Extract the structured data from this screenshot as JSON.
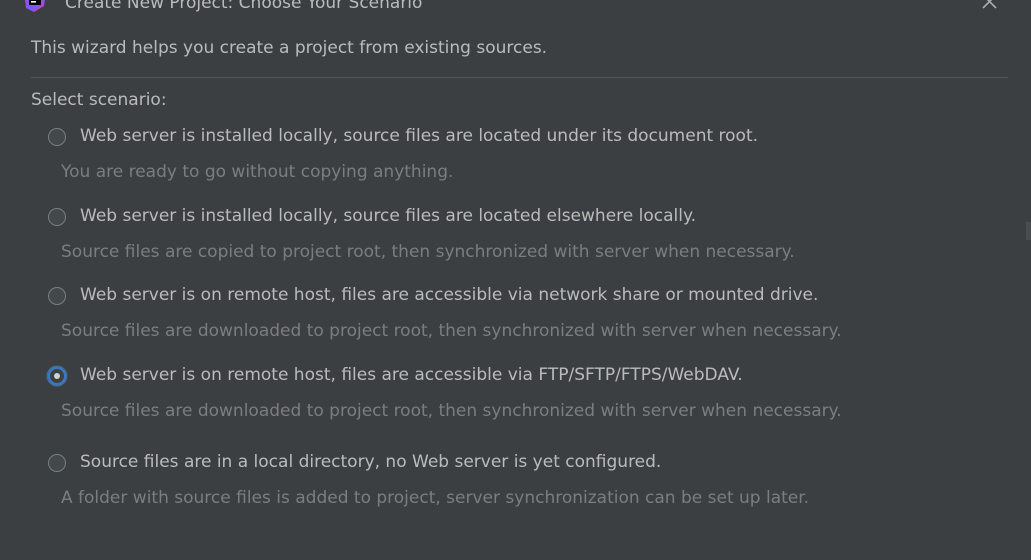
{
  "window": {
    "title": "Create New Project: Choose Your Scenario"
  },
  "intro_text": "This wizard helps you create a project from existing sources.",
  "select_label": "Select scenario:",
  "options": [
    {
      "label": "Web server is installed locally, source files are located under its document root.",
      "hint": "You are ready to go without copying anything.",
      "selected": false
    },
    {
      "label": "Web server is installed locally, source files are located elsewhere locally.",
      "hint": "Source files are copied to project root, then synchronized with server when necessary.",
      "selected": false
    },
    {
      "label": "Web server is on remote host, files are accessible via network share or mounted drive.",
      "hint": "Source files are downloaded to project root, then synchronized with server when necessary.",
      "selected": false
    },
    {
      "label": "Web server is on remote host, files are accessible via FTP/SFTP/FTPS/WebDAV.",
      "hint": "Source files are downloaded to project root, then synchronized with server when necessary.",
      "selected": true
    },
    {
      "label": "Source files are in a local directory, no Web server is yet configured.",
      "hint": "A folder with source files is added to project, server synchronization can be set up later.",
      "selected": false
    }
  ],
  "icons": {
    "app": "phpstorm-app-icon",
    "close": "close-icon"
  },
  "colors": {
    "background": "#3c3f41",
    "text": "#bbbbbb",
    "hint_text": "#7b7e80",
    "radio_selected_ring": "#3d76c4"
  }
}
